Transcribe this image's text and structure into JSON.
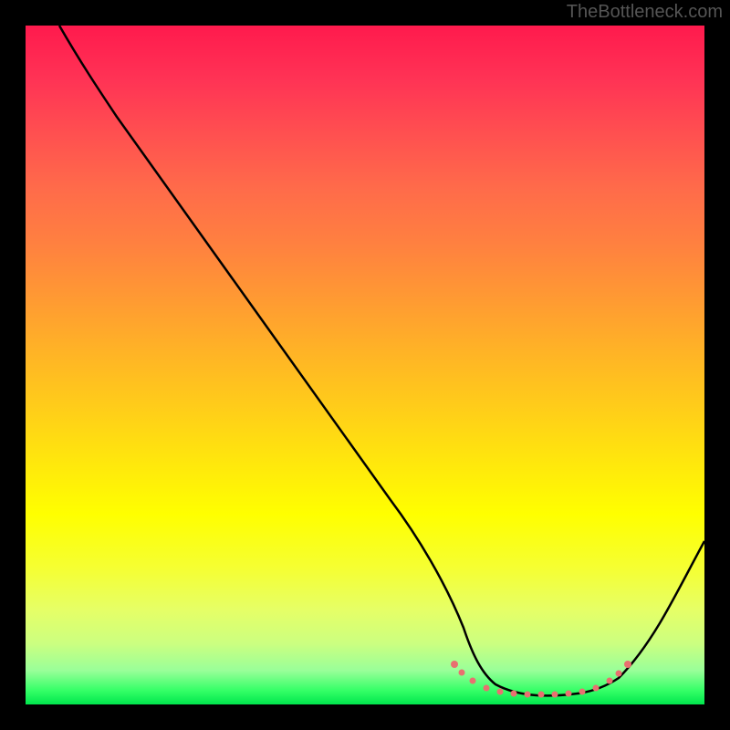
{
  "watermark": "TheBottleneck.com",
  "chart_data": {
    "type": "line",
    "title": "",
    "xlabel": "",
    "ylabel": "",
    "xlim": [
      0,
      100
    ],
    "ylim": [
      0,
      100
    ],
    "series": [
      {
        "name": "main-curve",
        "x": [
          5,
          10,
          15,
          20,
          25,
          30,
          35,
          40,
          45,
          50,
          55,
          60,
          63,
          66,
          69,
          72,
          75,
          78,
          81,
          84,
          87,
          90,
          93,
          96,
          100
        ],
        "y": [
          100,
          92,
          84,
          76,
          68,
          60,
          52,
          44,
          36,
          28,
          20,
          13,
          8,
          5,
          3,
          2,
          1.5,
          1.5,
          2,
          2.5,
          4,
          7,
          11,
          16,
          23
        ]
      }
    ],
    "dotted_segments": [
      {
        "x_start": 62,
        "x_end": 87,
        "y_level": 2
      }
    ],
    "dot_color": "#e87070",
    "curve_color": "#000000",
    "gradient_colors": {
      "top": "#ff1a4d",
      "middle": "#ffff00",
      "bottom": "#00e64d"
    }
  }
}
